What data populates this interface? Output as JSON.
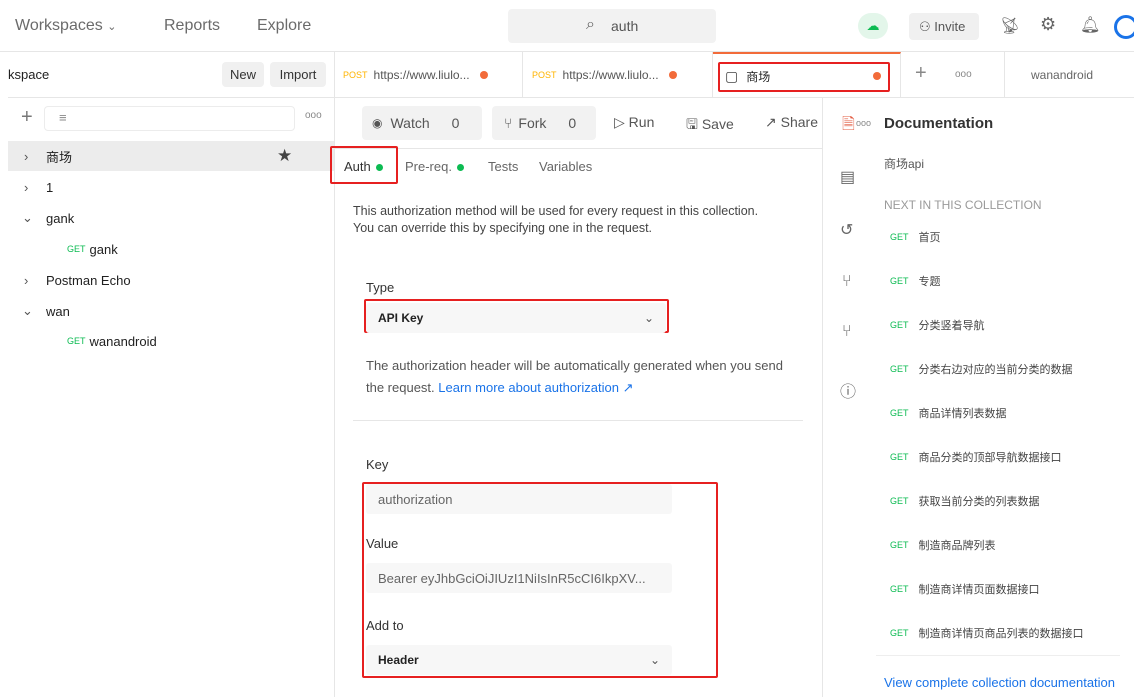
{
  "header": {
    "workspaces": "Workspaces",
    "reports": "Reports",
    "explore": "Explore",
    "search_value": "auth",
    "invite": "Invite"
  },
  "sidebar": {
    "title": "kspace",
    "new": "New",
    "import": "Import",
    "items": [
      {
        "label": "商场",
        "expanded": false
      },
      {
        "label": "1",
        "expanded": false
      },
      {
        "label": "gank",
        "expanded": true
      },
      {
        "method": "GET",
        "label": "gank"
      },
      {
        "label": "Postman Echo",
        "expanded": false
      },
      {
        "label": "wan",
        "expanded": true
      },
      {
        "method": "GET",
        "label": "wanandroid"
      }
    ]
  },
  "tabs": [
    {
      "method": "POST",
      "label": "https://www.liulo..."
    },
    {
      "method": "POST",
      "label": "https://www.liulo..."
    },
    {
      "label": "商场",
      "active": true
    },
    {
      "label": "wanandroid"
    }
  ],
  "toolbar": {
    "watch": "Watch",
    "watch_count": "0",
    "fork": "Fork",
    "fork_count": "0",
    "run": "Run",
    "save": "Save",
    "share": "Share"
  },
  "subtabs": {
    "auth": "Auth",
    "prereq": "Pre-req.",
    "tests": "Tests",
    "variables": "Variables"
  },
  "auth": {
    "description": "This authorization method will be used for every request in this collection. You can override this by specifying one in the request.",
    "type_label": "Type",
    "type_value": "API Key",
    "header_note": "The authorization header will be automatically generated when you send the request.",
    "learn_more": "Learn more about authorization ↗",
    "key_label": "Key",
    "key_value": "authorization",
    "value_label": "Value",
    "value_value": "Bearer eyJhbGciOiJIUzI1NiIsInR5cCI6IkpXV...",
    "addto_label": "Add to",
    "addto_value": "Header"
  },
  "docs": {
    "title": "Documentation",
    "collection_name": "商场api",
    "next_heading": "NEXT IN THIS COLLECTION",
    "items": [
      {
        "method": "GET",
        "label": "首页"
      },
      {
        "method": "GET",
        "label": "专题"
      },
      {
        "method": "GET",
        "label": "分类竖着导航"
      },
      {
        "method": "GET",
        "label": "分类右边对应的当前分类的数据"
      },
      {
        "method": "GET",
        "label": "商品详情列表数据"
      },
      {
        "method": "GET",
        "label": "商品分类的顶部导航数据接口"
      },
      {
        "method": "GET",
        "label": "获取当前分类的列表数据"
      },
      {
        "method": "GET",
        "label": "制造商品牌列表"
      },
      {
        "method": "GET",
        "label": "制造商详情页面数据接口"
      },
      {
        "method": "GET",
        "label": "制造商详情页商品列表的数据接口"
      }
    ],
    "view_all": "View complete collection documentation"
  }
}
